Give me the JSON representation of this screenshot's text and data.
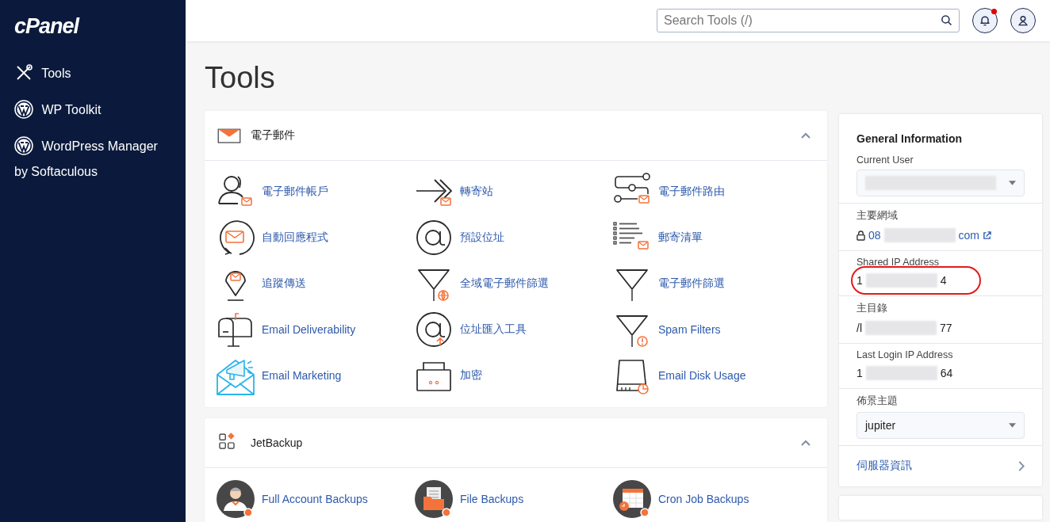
{
  "sidebar": {
    "logo": "cPanel",
    "items": [
      {
        "label": "Tools",
        "kind": "tools"
      },
      {
        "label": "WP Toolkit",
        "kind": "wordpress"
      },
      {
        "label": "WordPress Manager by Softaculous",
        "kind": "wordpress"
      }
    ]
  },
  "header": {
    "search": {
      "placeholder": "Search Tools (/)"
    },
    "notifications": {
      "unread": true
    }
  },
  "page_title": "Tools",
  "sections": [
    {
      "title": "電子郵件",
      "kind": "mail",
      "expanded": true,
      "tools": [
        {
          "label": "電子郵件帳戶",
          "kind": "user"
        },
        {
          "label": "轉寄站",
          "kind": "forward"
        },
        {
          "label": "電子郵件路由",
          "kind": "route"
        },
        {
          "label": "自動回應程式",
          "kind": "autoresponder"
        },
        {
          "label": "預設位址",
          "kind": "at"
        },
        {
          "label": "郵寄清單",
          "kind": "list"
        },
        {
          "label": "追蹤傳送",
          "kind": "pin"
        },
        {
          "label": "全域電子郵件篩選",
          "kind": "filter-globe"
        },
        {
          "label": "電子郵件篩選",
          "kind": "filter"
        },
        {
          "label": "Email Deliverability",
          "kind": "mailbox"
        },
        {
          "label": "位址匯入工具",
          "kind": "at-up"
        },
        {
          "label": "Spam Filters",
          "kind": "filter-alert"
        },
        {
          "label": "Email Marketing",
          "kind": "marketing"
        },
        {
          "label": "加密",
          "kind": "case"
        },
        {
          "label": "Email Disk Usage",
          "kind": "disk"
        }
      ]
    },
    {
      "title": "JetBackup",
      "kind": "jetbackup",
      "expanded": true,
      "tools": [
        {
          "label": "Full Account Backups",
          "kind": "backup-person"
        },
        {
          "label": "File Backups",
          "kind": "backup-folder"
        },
        {
          "label": "Cron Job Backups",
          "kind": "backup-calendar"
        }
      ]
    }
  ],
  "general_information": {
    "title": "General Information",
    "rows": [
      {
        "label": "Current User",
        "kind": "select",
        "redacted": true
      },
      {
        "label": "主要網域",
        "kind": "link",
        "value_start": "08",
        "value_end": "com",
        "redacted": true
      },
      {
        "label": "Shared IP Address",
        "kind": "text",
        "value_start": "1",
        "value_end": "4",
        "redacted": true,
        "highlighted": true
      },
      {
        "label": "主目錄",
        "kind": "text",
        "value_start": "/l",
        "value_end": "77",
        "redacted": true
      },
      {
        "label": "Last Login IP Address",
        "kind": "text",
        "value_start": "1",
        "value_end": "64",
        "redacted": true
      },
      {
        "label": "佈景主題",
        "kind": "select",
        "value": "jupiter"
      }
    ],
    "server_info_link": "伺服器資訊"
  }
}
